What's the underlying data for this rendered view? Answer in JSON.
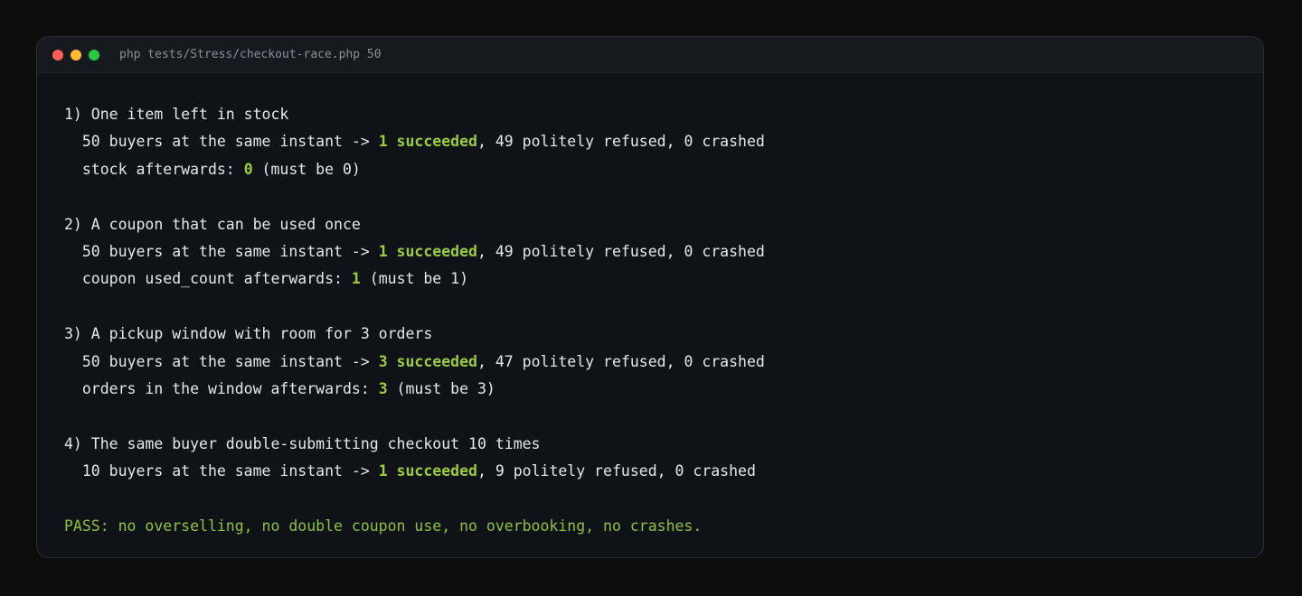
{
  "window": {
    "title": "php tests/Stress/checkout-race.php 50"
  },
  "colors": {
    "success": "#9ccc3b",
    "text": "#e6e8ea",
    "background": "#0f1317",
    "close": "#ff5f57",
    "minimize": "#febc2e",
    "maximize": "#28c840"
  },
  "output": {
    "s1": {
      "heading": "1) One item left in stock",
      "run_prefix": "  50 buyers at the same instant -> ",
      "run_ok": "1 succeeded",
      "run_suffix": ", 49 politely refused, 0 crashed",
      "check_prefix": "  stock afterwards: ",
      "check_value": "0",
      "check_suffix": " (must be 0)"
    },
    "s2": {
      "heading": "2) A coupon that can be used once",
      "run_prefix": "  50 buyers at the same instant -> ",
      "run_ok": "1 succeeded",
      "run_suffix": ", 49 politely refused, 0 crashed",
      "check_prefix": "  coupon used_count afterwards: ",
      "check_value": "1",
      "check_suffix": " (must be 1)"
    },
    "s3": {
      "heading": "3) A pickup window with room for 3 orders",
      "run_prefix": "  50 buyers at the same instant -> ",
      "run_ok": "3 succeeded",
      "run_suffix": ", 47 politely refused, 0 crashed",
      "check_prefix": "  orders in the window afterwards: ",
      "check_value": "3",
      "check_suffix": " (must be 3)"
    },
    "s4": {
      "heading": "4) The same buyer double-submitting checkout 10 times",
      "run_prefix": "  10 buyers at the same instant -> ",
      "run_ok": "1 succeeded",
      "run_suffix": ", 9 politely refused, 0 crashed"
    },
    "pass_line": "PASS: no overselling, no double coupon use, no overbooking, no crashes."
  }
}
